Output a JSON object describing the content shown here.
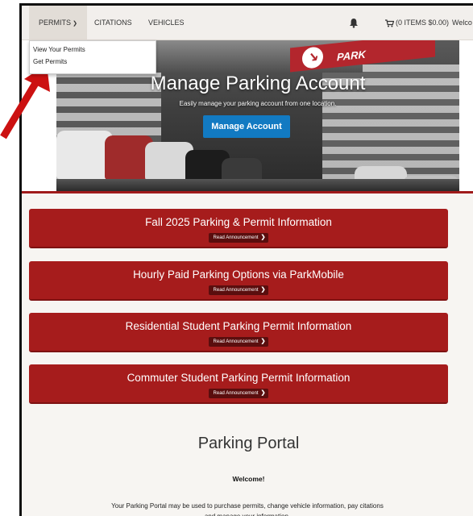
{
  "nav": {
    "permits_label": "PERMITS",
    "citations_label": "CITATIONS",
    "vehicles_label": "VEHICLES",
    "cart_label": "(0 ITEMS $0.00)",
    "welcome_label": "Welco"
  },
  "permits_menu": {
    "items": [
      {
        "label": "View Your Permits"
      },
      {
        "label": "Get Permits"
      }
    ]
  },
  "hero": {
    "title": "Manage Parking Account",
    "subtitle": "Easily manage your parking account from one location.",
    "button_label": "Manage Account",
    "sign_text": "PARK"
  },
  "announcements": [
    {
      "title": "Fall 2025 Parking & Permit Information",
      "link_label": "Read Announcement"
    },
    {
      "title": "Hourly Paid Parking Options via ParkMobile",
      "link_label": "Read Announcement"
    },
    {
      "title": "Residential Student Parking Permit Information",
      "link_label": "Read Announcement"
    },
    {
      "title": "Commuter Student Parking Permit Information",
      "link_label": "Read Announcement"
    }
  ],
  "portal": {
    "title": "Parking Portal",
    "welcome": "Welcome!",
    "description": "Your Parking Portal may be used to purchase permits, change vehicle information, pay citations and manage your information."
  },
  "icons": {
    "permits_chevron": "chevron-down-icon",
    "notifications": "bell-icon",
    "cart": "cart-icon",
    "read_more": "chevron-right-icon",
    "annotation": "red-arrow-icon"
  },
  "colors": {
    "announcement_bg": "#a61c1c",
    "button_blue": "#127ac2",
    "arrow_red": "#cc1111",
    "nav_bg": "#f2efec"
  }
}
